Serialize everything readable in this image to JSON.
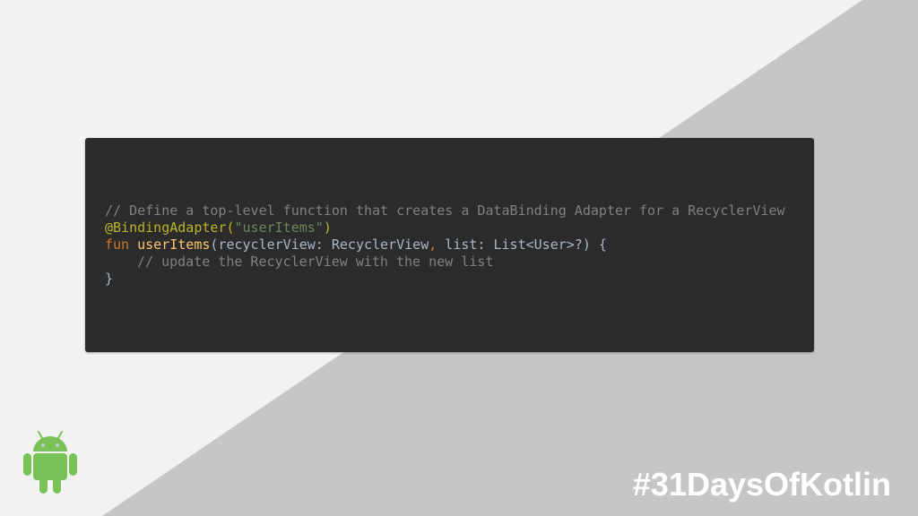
{
  "colors": {
    "background_light": "#f2f2f2",
    "background_dark": "#c6c6c4",
    "code_background": "#2b2b2b",
    "comment": "#808080",
    "annotation": "#bbb529",
    "string": "#6a8759",
    "keyword": "#cc7832",
    "function_name": "#ffc66d",
    "plain": "#a9b7c6",
    "android_green": "#78c257",
    "hashtag": "#ffffff"
  },
  "code": {
    "line1_comment": "// Define a top-level function that creates a DataBinding Adapter for a RecyclerView",
    "line2_annotation": "@BindingAdapter(",
    "line2_string": "\"userItems\"",
    "line2_close": ")",
    "line3_keyword": "fun ",
    "line3_fname": "userItems",
    "line3_params_a": "(recyclerView: RecyclerView",
    "line3_comma": ",",
    "line3_params_b": " list: List<User>?) {",
    "line4_comment": "// update the RecyclerView with the new list",
    "line5_close": "}"
  },
  "logo": {
    "icon": "android-robot-icon"
  },
  "hashtag": "#31DaysOfKotlin"
}
